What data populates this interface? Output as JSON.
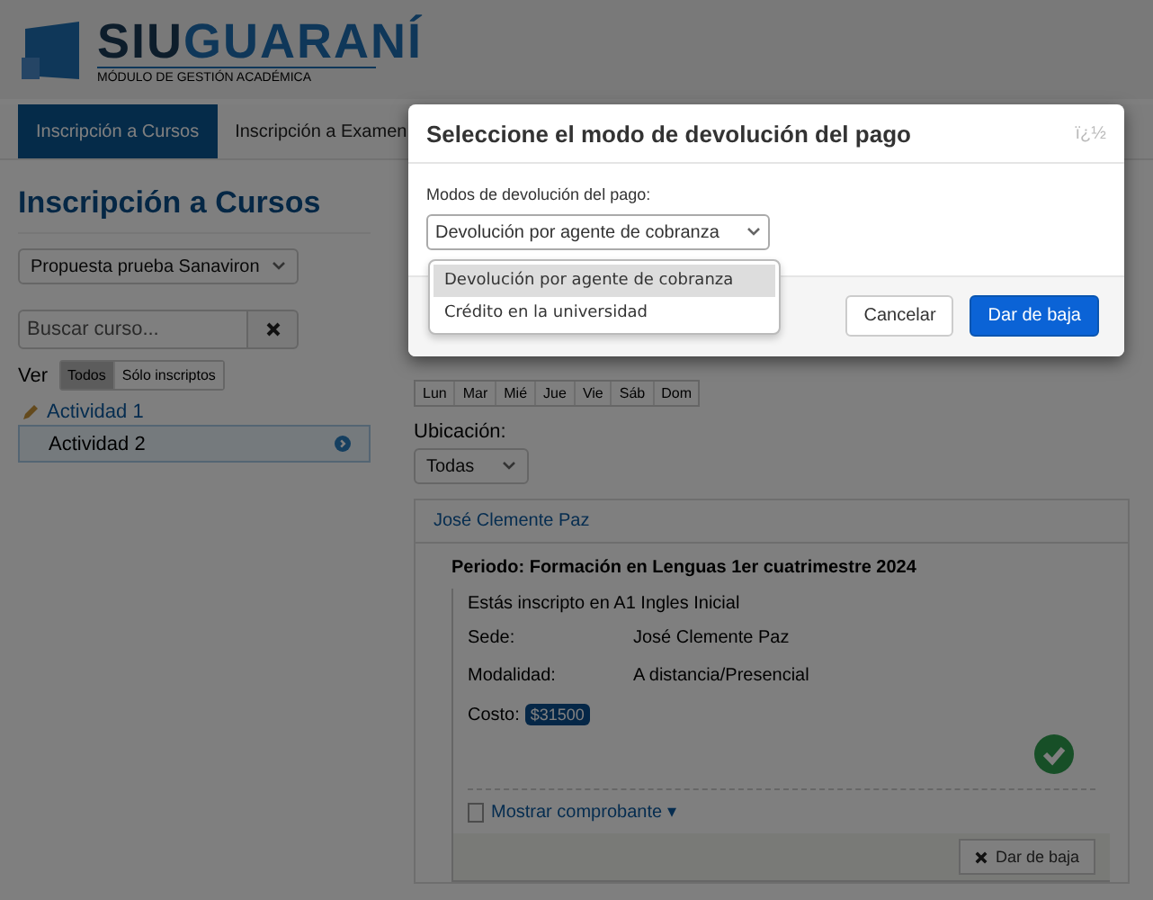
{
  "header": {
    "brand_prefix": "SIU",
    "brand_name": "GUARANÍ",
    "subtitle": "MÓDULO DE GESTIÓN ACADÉMICA"
  },
  "nav": [
    {
      "label": "Inscripción a Cursos",
      "selected": true
    },
    {
      "label": "Inscripción a Examen",
      "selected": false
    }
  ],
  "sidebar": {
    "title": "Inscripción a Cursos",
    "program_select": "Propuesta prueba Sanaviron",
    "search": {
      "placeholder": "Buscar curso..."
    },
    "view_label": "Ver",
    "view_filters": [
      {
        "label": "Todos",
        "selected": true
      },
      {
        "label": "Sólo inscriptos",
        "selected": false
      }
    ],
    "activities": [
      {
        "label": "Actividad 1",
        "selected": false
      },
      {
        "label": "Actividad 2",
        "selected": true
      }
    ]
  },
  "main": {
    "days": [
      {
        "label": "Lun"
      },
      {
        "label": "Mar"
      },
      {
        "label": "Mié"
      },
      {
        "label": "Jue"
      },
      {
        "label": "Vie"
      },
      {
        "label": "Sáb"
      },
      {
        "label": "Dom"
      }
    ],
    "location_label": "Ubicación:",
    "location_select": "Todas",
    "panel": {
      "title": "José Clemente Paz",
      "period": "Periodo: Formación en Lenguas 1er cuatrimestre 2024",
      "enrolled": "Estás inscripto en A1 Ingles Inicial",
      "fields": [
        {
          "label": "Sede:",
          "value": "José Clemente Paz"
        },
        {
          "label": "Modalidad:",
          "value": "A distancia/Presencial"
        }
      ],
      "cost_label": "Costo:",
      "cost": "$31500",
      "confirmed": true,
      "receipt_link": "Mostrar comprobante ▾",
      "drop_button": "Dar de baja"
    }
  },
  "dialog": {
    "title": "Seleccione el modo de devolución del pago",
    "corner_text": "ï¿½",
    "field_label": "Modos de devolución del pago:",
    "select_value": "Devolución por agente de cobranza",
    "options": [
      {
        "label": "Devolución por agente de cobranza",
        "selected": true
      },
      {
        "label": "Crédito en la universidad",
        "selected": false
      }
    ],
    "buttons": [
      {
        "label": "Cancelar",
        "kind": "secondary"
      },
      {
        "label": "Dar de baja",
        "kind": "primary"
      }
    ]
  }
}
